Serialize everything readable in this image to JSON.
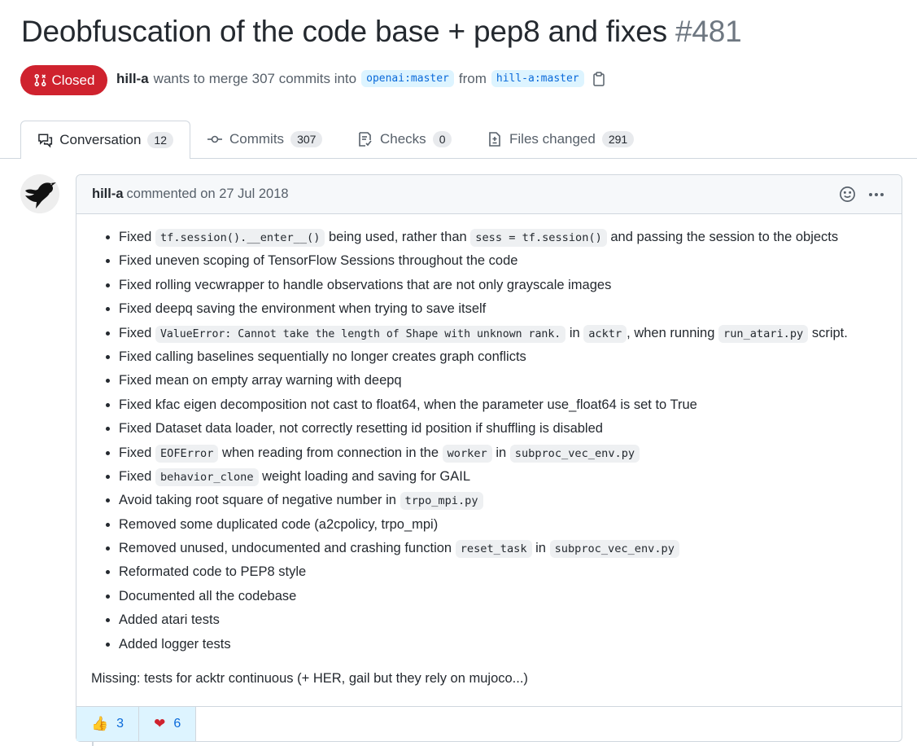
{
  "pr": {
    "title": "Deobfuscation of the code base + pep8 and fixes",
    "number": "#481",
    "state": "Closed",
    "author": "hill-a",
    "merge_text": "wants to merge 307 commits into",
    "base_branch": "openai:master",
    "from_text": "from",
    "head_branch": "hill-a:master"
  },
  "tabs": [
    {
      "label": "Conversation",
      "count": "12",
      "icon": "comment-discussion-icon"
    },
    {
      "label": "Commits",
      "count": "307",
      "icon": "git-commit-icon"
    },
    {
      "label": "Checks",
      "count": "0",
      "icon": "checklist-icon"
    },
    {
      "label": "Files changed",
      "count": "291",
      "icon": "file-diff-icon"
    }
  ],
  "comment": {
    "author": "hill-a",
    "meta": "commented on 27 Jul 2018",
    "items": [
      {
        "t1": "Fixed",
        "c1": "tf.session().__enter__()",
        "t2": "being used, rather than",
        "c2": "sess = tf.session()",
        "t3": "and passing the session to the objects"
      },
      {
        "t1": "Fixed uneven scoping of TensorFlow Sessions throughout the code"
      },
      {
        "t1": "Fixed rolling vecwrapper to handle observations that are not only grayscale images"
      },
      {
        "t1": "Fixed deepq saving the environment when trying to save itself"
      },
      {
        "t1": "Fixed",
        "c1": "ValueError: Cannot take the length of Shape with unknown rank.",
        "t2": "in",
        "c2": "acktr",
        "t3": ", when running",
        "c3": "run_atari.py",
        "t4": "script."
      },
      {
        "t1": "Fixed calling baselines sequentially no longer creates graph conflicts"
      },
      {
        "t1": "Fixed mean on empty array warning with deepq"
      },
      {
        "t1": "Fixed kfac eigen decomposition not cast to float64, when the parameter use_float64 is set to True"
      },
      {
        "t1": "Fixed Dataset data loader, not correctly resetting id position if shuffling is disabled"
      },
      {
        "t1": "Fixed",
        "c1": "EOFError",
        "t2": "when reading from connection in the",
        "c2": "worker",
        "t3": "in",
        "c3": "subproc_vec_env.py"
      },
      {
        "t1": "Fixed",
        "c1": "behavior_clone",
        "t2": "weight loading and saving for GAIL"
      },
      {
        "t1": "Avoid taking root square of negative number in",
        "c1": "trpo_mpi.py"
      },
      {
        "t1": "Removed some duplicated code (a2cpolicy, trpo_mpi)"
      },
      {
        "t1": "Removed unused, undocumented and crashing function",
        "c1": "reset_task",
        "t2": "in",
        "c2": "subproc_vec_env.py"
      },
      {
        "t1": "Reformated code to PEP8 style"
      },
      {
        "t1": "Documented all the codebase"
      },
      {
        "t1": "Added atari tests"
      },
      {
        "t1": "Added logger tests"
      }
    ],
    "missing": "Missing: tests for acktr continuous (+ HER, gail but they rely on mujoco...)"
  },
  "reactions": [
    {
      "emoji": "👍",
      "count": "3",
      "name": "thumbs-up"
    },
    {
      "emoji": "❤",
      "count": "6",
      "name": "heart"
    }
  ],
  "colors": {
    "closed": "#cf222e",
    "link": "#0969da",
    "branch_bg": "#ddf4ff",
    "border": "#d0d7de"
  }
}
